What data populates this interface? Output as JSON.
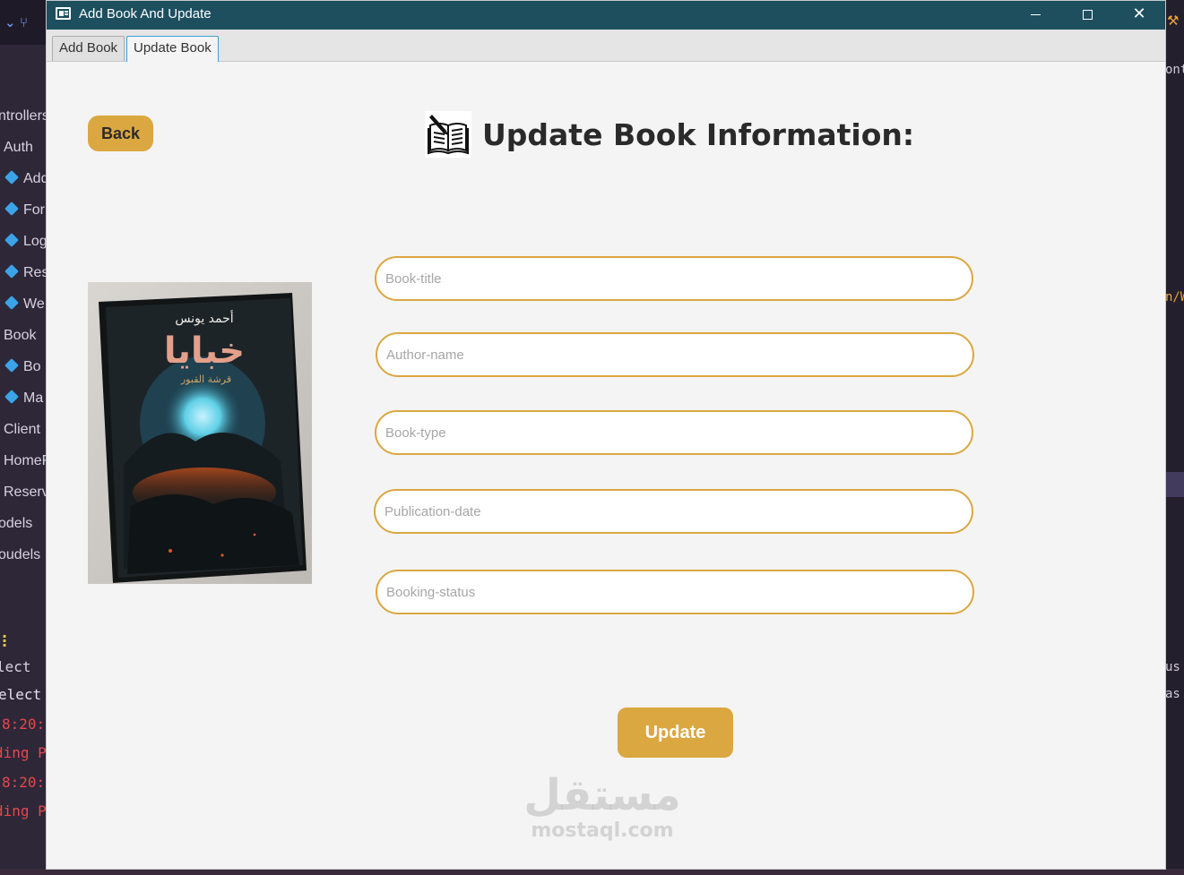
{
  "window": {
    "title": "Add Book And Update",
    "tabs": [
      {
        "label": "Add Book",
        "selected": false
      },
      {
        "label": "Update Book",
        "selected": true
      }
    ]
  },
  "page": {
    "heading": "Update Book Information:",
    "back_label": "Back",
    "update_label": "Update",
    "cover": {
      "author": "أحمد يونس",
      "title": "خبايا",
      "subtitle": "قرشة القبور"
    },
    "fields": [
      {
        "placeholder": "Book-title",
        "value": ""
      },
      {
        "placeholder": "Author-name",
        "value": ""
      },
      {
        "placeholder": "Book-type",
        "value": ""
      },
      {
        "placeholder": "Publication-date",
        "value": ""
      },
      {
        "placeholder": "Booking-status",
        "value": ""
      }
    ],
    "watermark": {
      "arabic": "مستقل",
      "latin": "mostaql.com"
    }
  },
  "background_ide": {
    "tree": [
      "ntrollers",
      "Auth",
      "Add",
      "For",
      "Log",
      "Res",
      "We",
      "Book",
      "Bo",
      "Ma",
      "Client",
      "HomeF",
      "Reserv",
      "odels",
      "oudels"
    ],
    "terminal": [
      "lect",
      "elect",
      "8:20:",
      "ding P",
      "8:20:",
      "ding P"
    ],
    "right_fragments": [
      "ont",
      "n/W",
      "us",
      "as"
    ]
  },
  "colors": {
    "accent": "#dba741",
    "titlebar": "#1d4f5f",
    "tab_focus": "#3ba0d8",
    "content_bg": "#f4f4f4"
  },
  "icons": [
    "window-app-icon",
    "minimize-icon",
    "maximize-icon",
    "close-icon",
    "open-book-icon"
  ]
}
